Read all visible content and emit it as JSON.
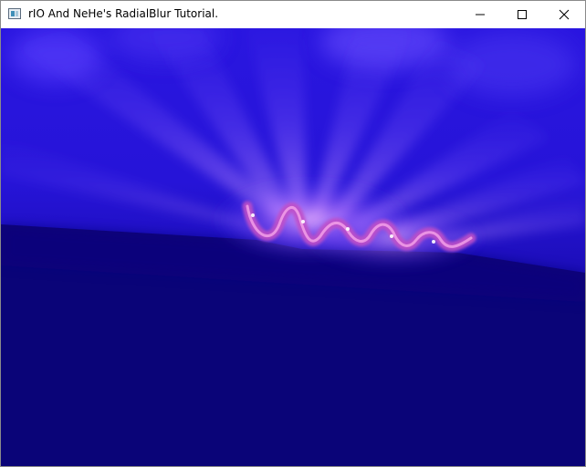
{
  "window": {
    "title": "rIO And NeHe's RadialBlur Tutorial.",
    "icon": "app-window-icon",
    "controls": {
      "minimize": "minimize-icon",
      "maximize": "maximize-icon",
      "close": "close-icon"
    }
  },
  "scene": {
    "background_color": "#0c0480",
    "glow_color": "#6a4cff",
    "helix_color": "#e06ad8",
    "description_icon": "opengl-viewport"
  }
}
